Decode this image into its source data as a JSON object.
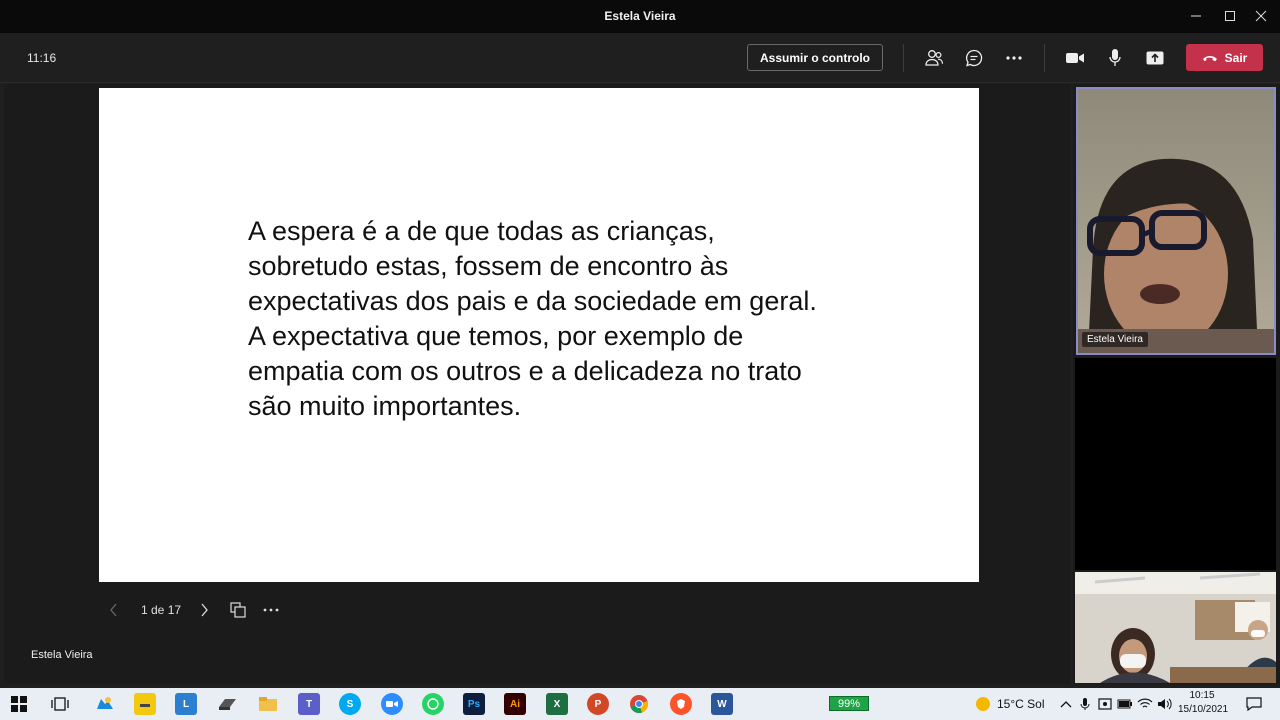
{
  "window": {
    "title": "Estela Vieira"
  },
  "toolbar": {
    "clock": "11:16",
    "take_control_label": "Assumir o controlo",
    "leave_label": "Sair",
    "icons": [
      "people-icon",
      "chat-icon",
      "more-icon",
      "camera-icon",
      "microphone-icon",
      "share-icon",
      "phone-icon"
    ]
  },
  "slide": {
    "lines": [
      "A espera é a de que todas as crianças,",
      "sobretudo estas, fossem  de encontro às",
      "expectativas dos pais e da sociedade em geral.",
      "A expectativa que temos, por exemplo de",
      "empatia com os outros e a delicadeza no trato",
      "são muito importantes."
    ],
    "page_indicator": "1 de 17"
  },
  "presenter": {
    "name": "Estela Vieira"
  },
  "participants": [
    {
      "name": "Estela Vieira"
    }
  ],
  "taskbar": {
    "battery": "99%",
    "weather": "15°C  Sol",
    "time": "10:15",
    "date": "15/10/2021",
    "apps": [
      "start",
      "task-view",
      "onedrive",
      "sticky",
      "lync",
      "ssd",
      "explorer",
      "teams",
      "skype",
      "zoom",
      "whatsapp",
      "photoshop",
      "illustrator",
      "excel",
      "powerpoint",
      "chrome",
      "brave",
      "word"
    ],
    "colors": {
      "teams": "#5b5fc7",
      "leave": "#c4314b",
      "battery": "#1ea446",
      "active_border": "#8b8cc7"
    }
  }
}
